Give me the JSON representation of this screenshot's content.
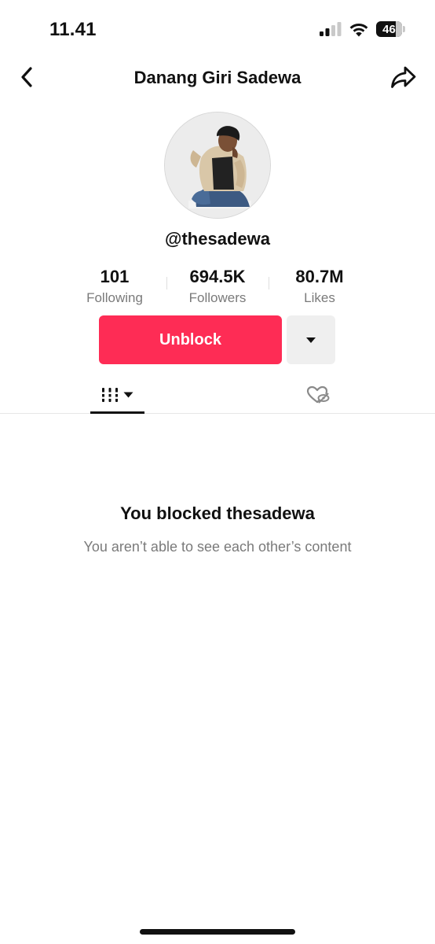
{
  "status_bar": {
    "time": "11.41",
    "battery_level": "46",
    "icons": [
      "cellular-signal-icon",
      "wifi-icon",
      "battery-icon"
    ]
  },
  "header": {
    "title": "Danang Giri Sadewa",
    "back_icon": "chevron-left-icon",
    "share_icon": "share-arrow-icon"
  },
  "profile": {
    "username": "@thesadewa",
    "stats": [
      {
        "value": "101",
        "label": "Following"
      },
      {
        "value": "694.5K",
        "label": "Followers"
      },
      {
        "value": "80.7M",
        "label": "Likes"
      }
    ],
    "actions": {
      "unblock_label": "Unblock",
      "more_icon": "caret-down-icon"
    }
  },
  "tabs": [
    {
      "icon": "videos-grid-icon",
      "dropdown_icon": "caret-down-icon",
      "active": true
    },
    {
      "icon": "liked-hidden-icon",
      "active": false
    }
  ],
  "blocked_state": {
    "title": "You blocked thesadewa",
    "message": "You aren’t able to see each other’s content"
  },
  "colors": {
    "accent": "#fe2c55",
    "text_primary": "#111111",
    "text_secondary": "#7a7a7a",
    "button_secondary_bg": "#efefef"
  }
}
